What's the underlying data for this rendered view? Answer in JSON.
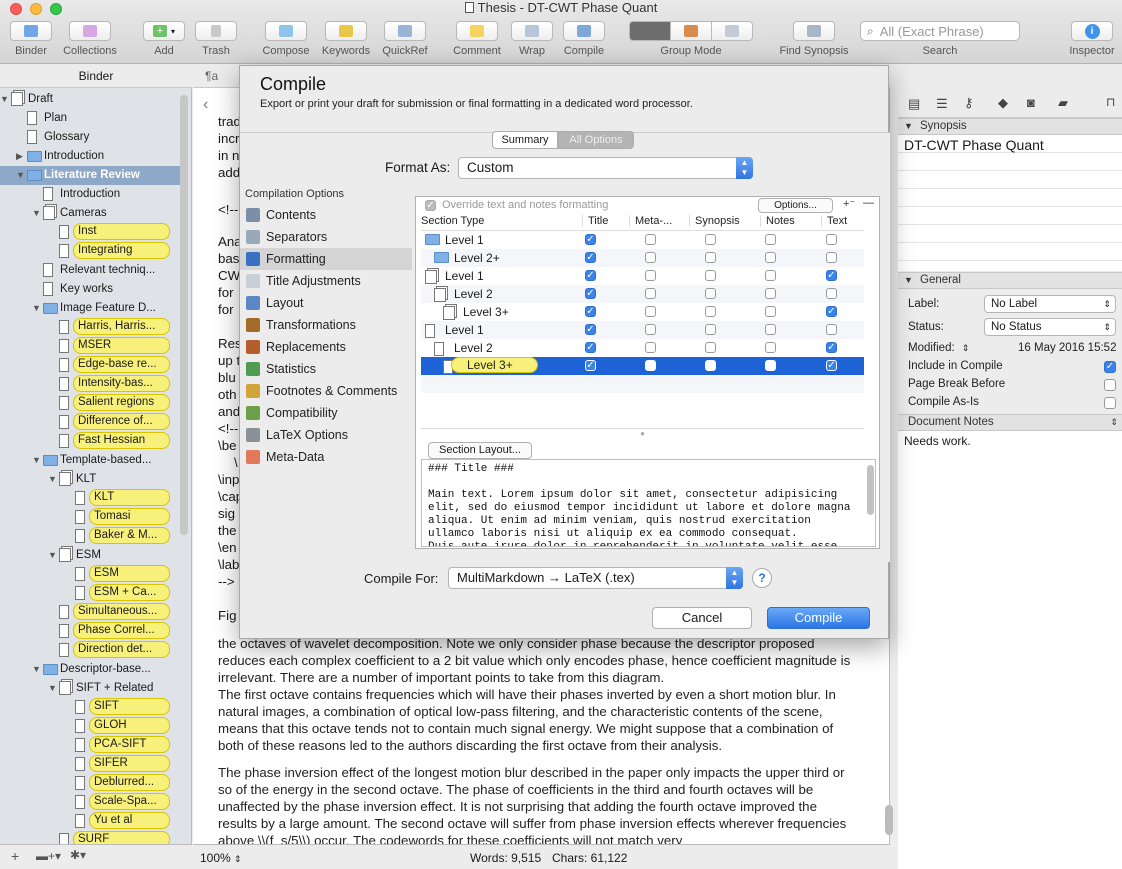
{
  "window": {
    "title": "Thesis - DT-CWT Phase Quant"
  },
  "toolbar": {
    "binder": "Binder",
    "collections": "Collections",
    "add": "Add",
    "trash": "Trash",
    "compose": "Compose",
    "keywords": "Keywords",
    "quickref": "QuickRef",
    "comment": "Comment",
    "wrap": "Wrap",
    "compile": "Compile",
    "group_mode": "Group Mode",
    "find_synopsis": "Find Synopsis",
    "search_placeholder": "All (Exact Phrase)",
    "search": "Search",
    "inspector": "Inspector"
  },
  "binder": {
    "header": "Binder",
    "items": [
      {
        "label": "Draft",
        "level": 0,
        "kind": "stack",
        "expanded": true
      },
      {
        "label": "Plan",
        "level": 1,
        "kind": "doc"
      },
      {
        "label": "Glossary",
        "level": 1,
        "kind": "doc"
      },
      {
        "label": "Introduction",
        "level": 1,
        "kind": "folder",
        "collapsed": true
      },
      {
        "label": "Literature Review",
        "level": 1,
        "kind": "folder",
        "selected": true,
        "expanded": true
      },
      {
        "label": "Introduction",
        "level": 2,
        "kind": "doc"
      },
      {
        "label": "Cameras",
        "level": 2,
        "kind": "stack",
        "expanded": true
      },
      {
        "label": "Inst",
        "level": 3,
        "kind": "doc",
        "highlight": true
      },
      {
        "label": "Integrating",
        "level": 3,
        "kind": "doc",
        "highlight": true
      },
      {
        "label": "Relevant techniq...",
        "level": 2,
        "kind": "doc"
      },
      {
        "label": "Key works",
        "level": 2,
        "kind": "doc"
      },
      {
        "label": "Image Feature D...",
        "level": 2,
        "kind": "folder",
        "expanded": true
      },
      {
        "label": "Harris, Harris...",
        "level": 3,
        "kind": "doc",
        "highlight": true
      },
      {
        "label": "MSER",
        "level": 3,
        "kind": "doc",
        "highlight": true
      },
      {
        "label": "Edge-base re...",
        "level": 3,
        "kind": "doc",
        "highlight": true
      },
      {
        "label": "Intensity-bas...",
        "level": 3,
        "kind": "doc",
        "highlight": true
      },
      {
        "label": "Salient regions",
        "level": 3,
        "kind": "doc",
        "highlight": true
      },
      {
        "label": "Difference of...",
        "level": 3,
        "kind": "doc",
        "highlight": true
      },
      {
        "label": "Fast Hessian",
        "level": 3,
        "kind": "doc",
        "highlight": true
      },
      {
        "label": "Template-based...",
        "level": 2,
        "kind": "folder",
        "expanded": true
      },
      {
        "label": "KLT",
        "level": 3,
        "kind": "stack",
        "expanded": true
      },
      {
        "label": "KLT",
        "level": 4,
        "kind": "doc",
        "highlight": true
      },
      {
        "label": "Tomasi",
        "level": 4,
        "kind": "doc",
        "highlight": true
      },
      {
        "label": "Baker & M...",
        "level": 4,
        "kind": "doc",
        "highlight": true
      },
      {
        "label": "ESM",
        "level": 3,
        "kind": "stack",
        "expanded": true
      },
      {
        "label": "ESM",
        "level": 4,
        "kind": "doc",
        "highlight": true
      },
      {
        "label": "ESM + Ca...",
        "level": 4,
        "kind": "doc",
        "highlight": true
      },
      {
        "label": "Simultaneous...",
        "level": 3,
        "kind": "doc",
        "highlight": true
      },
      {
        "label": "Phase Correl...",
        "level": 3,
        "kind": "doc",
        "highlight": true
      },
      {
        "label": "Direction det...",
        "level": 3,
        "kind": "doc",
        "highlight": true
      },
      {
        "label": "Descriptor-base...",
        "level": 2,
        "kind": "folder",
        "expanded": true
      },
      {
        "label": "SIFT + Related",
        "level": 3,
        "kind": "stack",
        "expanded": true
      },
      {
        "label": "SIFT",
        "level": 4,
        "kind": "doc",
        "highlight": true
      },
      {
        "label": "GLOH",
        "level": 4,
        "kind": "doc",
        "highlight": true
      },
      {
        "label": "PCA-SIFT",
        "level": 4,
        "kind": "doc",
        "highlight": true
      },
      {
        "label": "SIFER",
        "level": 4,
        "kind": "doc",
        "highlight": true
      },
      {
        "label": "Deblurred...",
        "level": 4,
        "kind": "doc",
        "highlight": true
      },
      {
        "label": "Scale-Spa...",
        "level": 4,
        "kind": "doc",
        "highlight": true
      },
      {
        "label": "Yu et al",
        "level": 4,
        "kind": "doc",
        "highlight": true
      },
      {
        "label": "SURF",
        "level": 3,
        "kind": "doc",
        "highlight": true
      }
    ]
  },
  "editor": {
    "format_label": "¶a",
    "left_fragments": [
      "trad",
      "incr",
      "in n",
      "add",
      "<!--",
      "Ana",
      "bas",
      "CW",
      "for",
      "for",
      "Res",
      "up t",
      "blu",
      "oth",
      "and",
      "<!--",
      "\\be",
      "\\",
      "\\inp",
      "\\cap",
      "sig",
      "the",
      "\\en",
      "\\lab",
      "-->",
      "Fig"
    ],
    "para1": "the octaves of wavelet decomposition. Note we only consider phase because the descriptor proposed reduces each complex coefficient to a 2 bit value which only encodes phase, hence coefficient magnitude is irrelevant. There are a number of important points to take from this diagram.",
    "para2": "The first octave contains frequencies which will have their phases inverted by even a short motion blur. In natural images, a combination of optical low-pass filtering, and the characteristic contents of the scene, means that this octave tends not to contain much signal energy. We might suppose that a combination of both of these reasons led to the authors discarding the first octave from their analysis.",
    "para3": "The phase inversion effect of the longest motion blur described in the paper only impacts the upper third or so of the energy in the second octave. The phase of coefficients in the third and fourth octaves will be unaffected by the phase inversion effect. It is not surprising that adding the fourth octave improved the results by a large amount. The second octave will suffer from phase inversion effects wherever frequencies above \\\\(f_s/5\\\\) occur. The codewords for these coefficients will not match very",
    "zoom": "100%",
    "words": "Words: 9,515",
    "chars": "Chars: 61,122"
  },
  "inspector": {
    "synopsis_header": "Synopsis",
    "synopsis_title": "DT-CWT Phase Quant",
    "general_header": "General",
    "label_label": "Label:",
    "label_value": "No Label",
    "status_label": "Status:",
    "status_value": "No Status",
    "modified_label": "Modified:",
    "modified_value": "16 May 2016 15:52",
    "include_label": "Include in Compile",
    "include_checked": true,
    "pagebreak_label": "Page Break Before",
    "pagebreak_checked": false,
    "compileasis_label": "Compile As-Is",
    "compileasis_checked": false,
    "notes_header": "Document Notes",
    "notes_text": "Needs work."
  },
  "dialog": {
    "title": "Compile",
    "subtitle": "Export or print your draft for submission or final formatting in a dedicated word processor.",
    "tab_summary": "Summary",
    "tab_all": "All Options",
    "format_label": "Format As:",
    "format_value": "Custom",
    "options_header": "Compilation Options",
    "options": [
      {
        "label": "Contents",
        "color": "#7d8fa8"
      },
      {
        "label": "Separators",
        "color": "#9aa8b8"
      },
      {
        "label": "Formatting",
        "color": "#3b6fc4",
        "selected": true
      },
      {
        "label": "Title Adjustments",
        "color": "#c9cfd6"
      },
      {
        "label": "Layout",
        "color": "#5d86c4"
      },
      {
        "label": "Transformations",
        "color": "#a46a2a"
      },
      {
        "label": "Replacements",
        "color": "#b55e2b"
      },
      {
        "label": "Statistics",
        "color": "#4f9b4f"
      },
      {
        "label": "Footnotes & Comments",
        "color": "#d1a43a"
      },
      {
        "label": "Compatibility",
        "color": "#6aa04a"
      },
      {
        "label": "LaTeX Options",
        "color": "#8b8f96"
      },
      {
        "label": "Meta-Data",
        "color": "#e07a5a"
      }
    ],
    "override_label": "Override text and notes formatting",
    "options_btn": "Options...",
    "columns": [
      "Section Type",
      "Title",
      "Meta-...",
      "Synopsis",
      "Notes",
      "Text"
    ],
    "rows": [
      {
        "name": "Level  1",
        "indent": 0,
        "kind": "folder",
        "checks": [
          true,
          false,
          false,
          false,
          false
        ]
      },
      {
        "name": "Level  2+",
        "indent": 1,
        "kind": "folder",
        "checks": [
          true,
          false,
          false,
          false,
          false
        ]
      },
      {
        "name": "Level  1",
        "indent": 0,
        "kind": "stack",
        "checks": [
          true,
          false,
          false,
          false,
          true
        ]
      },
      {
        "name": "Level  2",
        "indent": 1,
        "kind": "stack",
        "checks": [
          true,
          false,
          false,
          false,
          false
        ]
      },
      {
        "name": "Level  3+",
        "indent": 2,
        "kind": "stack",
        "checks": [
          true,
          false,
          false,
          false,
          true
        ]
      },
      {
        "name": "Level  1",
        "indent": 0,
        "kind": "doc",
        "checks": [
          true,
          false,
          false,
          false,
          false
        ]
      },
      {
        "name": "Level  2",
        "indent": 1,
        "kind": "doc",
        "checks": [
          true,
          false,
          false,
          false,
          true
        ]
      },
      {
        "name": "Level  3+",
        "indent": 2,
        "kind": "doc",
        "selected": true,
        "checks": [
          true,
          false,
          false,
          false,
          true
        ]
      }
    ],
    "section_layout_btn": "Section Layout...",
    "preview_text": "### Title ###\n\nMain text. Lorem ipsum dolor sit amet, consectetur adipisicing\nelit, sed do eiusmod tempor incididunt ut labore et dolore magna\naliqua. Ut enim ad minim veniam, quis nostrud exercitation\nullamco laboris nisi ut aliquip ex ea commodo consequat.\nDuis aute irure dolor in reprehenderit in voluptate velit esse",
    "compile_for_label": "Compile For:",
    "compile_for_value": "MultiMarkdown → LaTeX (.tex)",
    "help": "?",
    "cancel": "Cancel",
    "compile": "Compile"
  },
  "colors": {
    "highlight": "#f7f07a",
    "selection": "#1d63d6",
    "binder_selection": "#8ea8c8",
    "accent": "#2b76e6"
  }
}
